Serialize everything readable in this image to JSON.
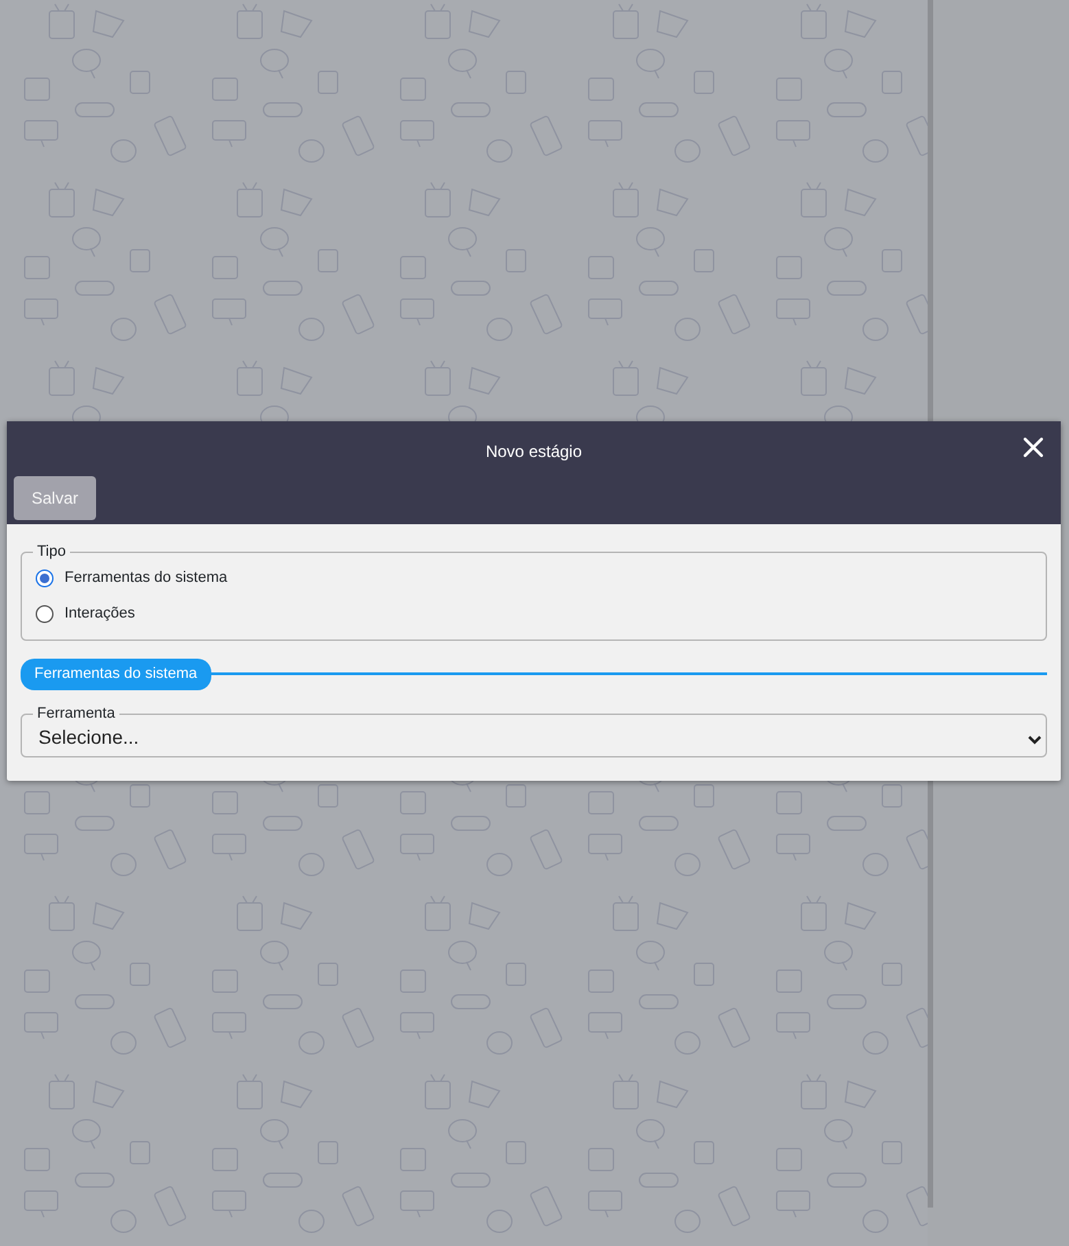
{
  "modal": {
    "title": "Novo estágio",
    "save_button": "Salvar",
    "tipo": {
      "legend": "Tipo",
      "options": [
        {
          "label": "Ferramentas do sistema",
          "selected": true
        },
        {
          "label": "Interações",
          "selected": false
        }
      ]
    },
    "section_label": "Ferramentas do sistema",
    "ferramenta": {
      "legend": "Ferramenta",
      "value": "Selecione..."
    }
  }
}
